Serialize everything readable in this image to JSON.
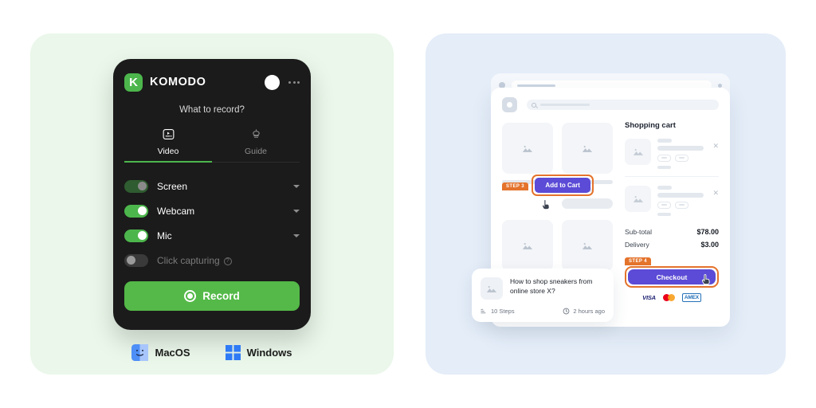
{
  "theme": {
    "left_panel_bg": "#eaf7ea",
    "right_panel_bg": "#e4edf8",
    "komodo_bg": "#1b1b1b",
    "brand_green": "#4cb64c",
    "record_green": "#54b948",
    "accent_purple": "#5b4bd6",
    "accent_orange": "#e4732c"
  },
  "recorder": {
    "brand": "KOMODO",
    "logo_letter": "K",
    "question": "What to record?",
    "tabs": [
      {
        "label": "Video",
        "icon": "video-icon",
        "active": true
      },
      {
        "label": "Guide",
        "icon": "guide-icon",
        "active": false
      }
    ],
    "sources": [
      {
        "label": "Screen",
        "state": "muted",
        "has_caret": true,
        "has_help": false
      },
      {
        "label": "Webcam",
        "state": "on",
        "has_caret": true,
        "has_help": false
      },
      {
        "label": "Mic",
        "state": "on",
        "has_caret": true,
        "has_help": false
      },
      {
        "label": "Click capturing",
        "state": "off",
        "has_caret": false,
        "has_help": true
      }
    ],
    "record_label": "Record",
    "platforms": [
      {
        "label": "MacOS",
        "icon": "macos-finder-icon"
      },
      {
        "label": "Windows",
        "icon": "windows-logo-icon"
      }
    ]
  },
  "store": {
    "cart_title": "Shopping cart",
    "add_to_cart": {
      "step_badge": "STEP 3",
      "label": "Add to Cart"
    },
    "totals": [
      {
        "label": "Sub-total",
        "amount": "$78.00"
      },
      {
        "label": "Delivery",
        "amount": "$3.00"
      }
    ],
    "checkout": {
      "step_badge": "STEP 4",
      "label": "Checkout"
    },
    "payments": [
      {
        "name": "VISA",
        "type": "visa"
      },
      {
        "name": "Mastercard",
        "type": "mastercard"
      },
      {
        "name": "AMEX",
        "type": "amex"
      }
    ]
  },
  "guide_card": {
    "title": "How to shop sneakers from online store X?",
    "steps": "10 Steps",
    "time": "2 hours ago"
  }
}
